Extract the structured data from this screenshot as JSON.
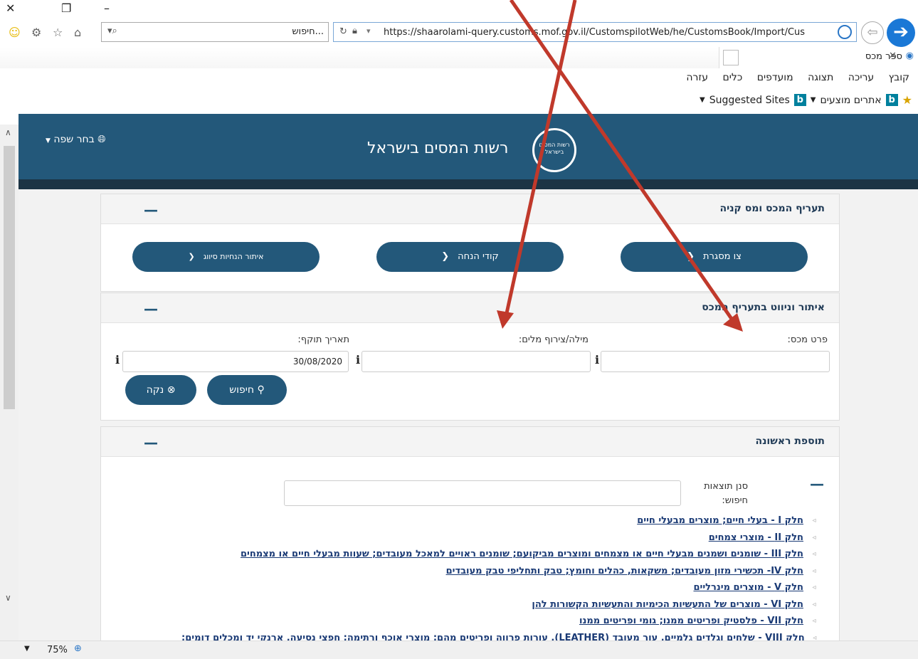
{
  "browser": {
    "search_text": "חיפוש...",
    "url": "https://shaarolami-query.customs.mof.gov.il/CustomspilotWeb/he/CustomsBook/Import/Cus",
    "tab_title": "ספר מכס",
    "menu": [
      "קובץ",
      "עריכה",
      "תצוגה",
      "מועדפים",
      "כלים",
      "עזרה"
    ],
    "favorites": [
      "אתרים מוצעים",
      "Suggested Sites"
    ],
    "zoom": "75%"
  },
  "header": {
    "language_label": "בחר שפה",
    "site_title": "רשות המסים בישראל",
    "logo_text": "רשות המסים בישראל"
  },
  "panel_tariff": {
    "title": "תעריף המכס ומס קניה",
    "buttons": [
      "צו מסגרת",
      "קודי הנחה",
      "איתור הנחיות סיווג"
    ]
  },
  "panel_search": {
    "title": "איתור וניווט בתעריף המכס",
    "customs_item_label": "פרט מכס:",
    "words_label": "מילה/צירוף מלים:",
    "date_label": "תאריך תוקף:",
    "date_value": "30/08/2020",
    "info_glyph": "i",
    "search_button": "חיפוש",
    "clear_button": "נקה"
  },
  "panel_first_addition": {
    "title": "תוספת ראשונה",
    "filter_label": "סנן תוצאות חיפוש:",
    "items": [
      "חלק I - בעלי חיים; מוצרים מבעלי חיים",
      "חלק II - מוצרי צמחים",
      "חלק III - שומנים ושמנים מבעלי חיים או מצמחים ומוצרים מביקועם; שומנים ראויים למאכל מעובדים; שעוות מבעלי חיים או מצמחים",
      "חלק IV- תכשירי מזון מעובדים; משקאות, כהלים וחומץ; טבק ותחליפי טבק מעובדים",
      "חלק V - מוצרים מינרליים",
      "חלק VI - מוצרים של התעשיות הכימיות והתעשיות הקשורות להן",
      "חלק VII - פלסטיק ופריטים ממנו; גומי ופריטים ממנו",
      "חלק VIII - שלחים וגלדים גלמיים, עור מעובד (LEATHER), עורות פרווה ופריטים מהם; מוצרי אוכף ורתימה; חפצי נסיעה, ארנקי יד ומכלים דומים;"
    ]
  },
  "annotation": {
    "arrow_color": "#c0392b"
  }
}
